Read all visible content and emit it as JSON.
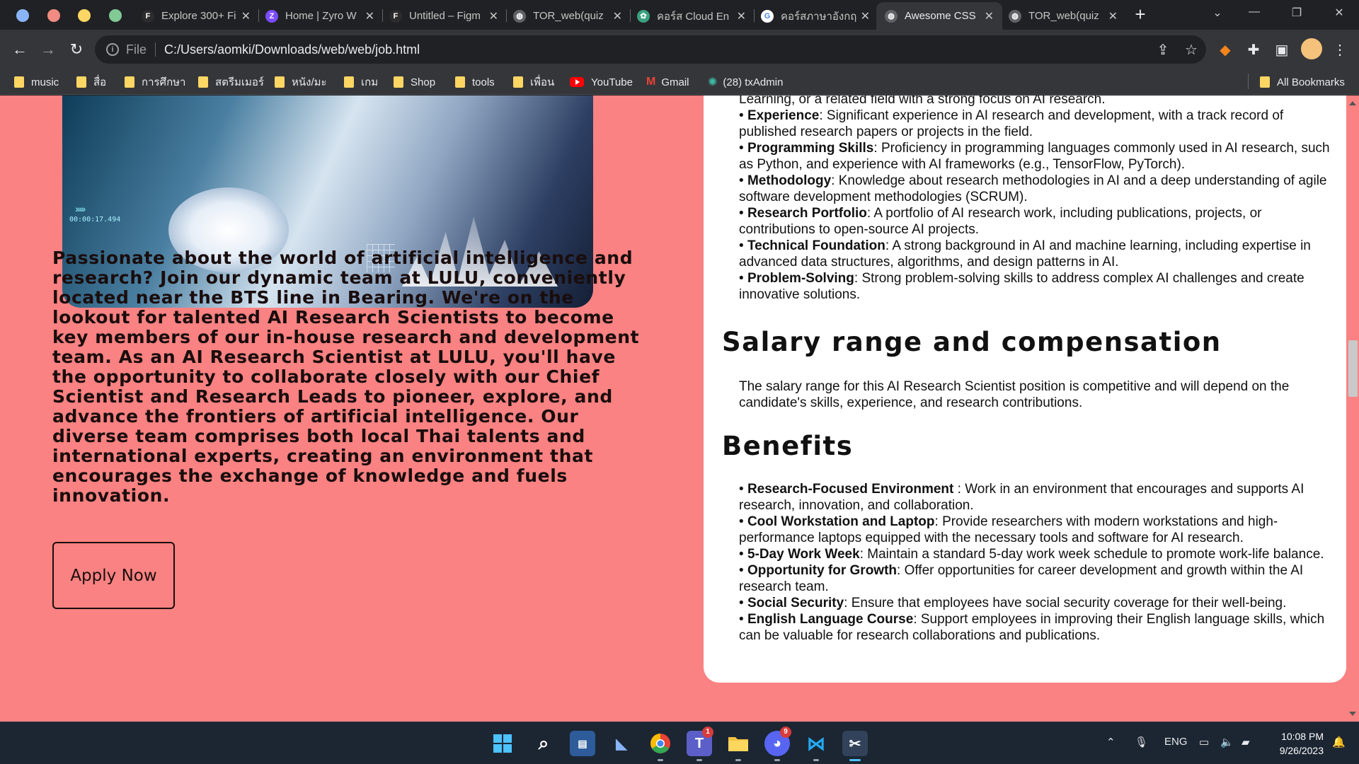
{
  "tabs": [
    {
      "title": "Explore 300+ Fi",
      "favicon_color": "#2c2c2c",
      "favicon_glyph": "F"
    },
    {
      "title": "Home | Zyro W",
      "favicon_color": "#7b4cff",
      "favicon_glyph": "Z"
    },
    {
      "title": "Untitled – Figm",
      "favicon_color": "#2c2c2c",
      "favicon_glyph": "F"
    },
    {
      "title": "TOR_web(quiz",
      "favicon_color": "#5f6368",
      "favicon_glyph": "◍"
    },
    {
      "title": "คอร์ส Cloud En",
      "favicon_color": "#3aa17e",
      "favicon_glyph": "✿"
    },
    {
      "title": "คอร์สภาษาอังกฤ",
      "favicon_color": "#ffffff",
      "favicon_glyph": "G"
    },
    {
      "title": "Awesome CSS",
      "favicon_color": "#5f6368",
      "favicon_glyph": "◍"
    },
    {
      "title": "TOR_web(quiz",
      "favicon_color": "#5f6368",
      "favicon_glyph": "◍"
    }
  ],
  "omnibox": {
    "scheme": "File",
    "url": "C:/Users/aomki/Downloads/web/web/job.html"
  },
  "bookmarks": [
    {
      "label": "music",
      "icon": "folder-icon"
    },
    {
      "label": "สื่อ",
      "icon": "folder-icon"
    },
    {
      "label": "การศึกษา",
      "icon": "folder-icon"
    },
    {
      "label": "สตรีมเมอร์",
      "icon": "folder-icon"
    },
    {
      "label": "หนัง/มะ",
      "icon": "folder-icon"
    },
    {
      "label": "เกม",
      "icon": "folder-icon"
    },
    {
      "label": "Shop",
      "icon": "folder-icon"
    },
    {
      "label": "tools",
      "icon": "folder-icon"
    },
    {
      "label": "เพื่อน",
      "icon": "folder-icon"
    },
    {
      "label": "YouTube",
      "icon": "youtube-icon"
    },
    {
      "label": "Gmail",
      "icon": "gmail-icon"
    },
    {
      "label": "(28) txAdmin",
      "icon": "txadmin-icon"
    }
  ],
  "all_bookmarks": "All Bookmarks",
  "page": {
    "hero_hud": "00:00:17.494",
    "intro": "Passionate about the world of artificial intelligence and research? Join our dynamic team at LULU, conveniently located near the BTS line in Bearing. We're on the lookout for talented AI Research Scientists to become key members of our in-house research and development team. As an AI Research Scientist at LULU, you'll have the opportunity to collaborate closely with our Chief Scientist and Research Leads to pioneer, explore, and advance the frontiers of artificial intelligence. Our diverse team comprises both local Thai talents and international experts, creating an environment that encourages the exchange of knowledge and fuels innovation.",
    "apply_label": "Apply Now",
    "cut_line": "Learning, or a related field with a strong focus on AI research.",
    "requirements": [
      {
        "bold": "Experience",
        "text": ": Significant experience in AI research and development, with a track record of published research papers or projects in the field."
      },
      {
        "bold": "Programming Skills",
        "text": ": Proficiency in programming languages commonly used in AI research, such as Python, and experience with AI frameworks (e.g., TensorFlow, PyTorch)."
      },
      {
        "bold": "Methodology",
        "text": ": Knowledge about research methodologies in AI and a deep understanding of agile software development methodologies (SCRUM)."
      },
      {
        "bold": "Research Portfolio",
        "text": ": A portfolio of AI research work, including publications, projects, or contributions to open-source AI projects."
      },
      {
        "bold": "Technical Foundation",
        "text": ": A strong background in AI and machine learning, including expertise in advanced data structures, algorithms, and design patterns in AI."
      },
      {
        "bold": "Problem-Solving",
        "text": ": Strong problem-solving skills to address complex AI challenges and create innovative solutions."
      }
    ],
    "salary_heading": "Salary range and compensation",
    "salary_text": "The salary range for this AI Research Scientist position is competitive and will depend on the candidate's skills, experience, and research contributions.",
    "benefits_heading": "Benefits",
    "benefits": [
      {
        "bold": "Research-Focused Environment",
        "text": " : Work in an environment that encourages and supports AI research, innovation, and collaboration."
      },
      {
        "bold": "Cool Workstation and Laptop",
        "text": ": Provide researchers with modern workstations and high-performance laptops equipped with the necessary tools and software for AI research."
      },
      {
        "bold": "5-Day Work Week",
        "text": ": Maintain a standard 5-day work week schedule to promote work-life balance."
      },
      {
        "bold": "Opportunity for Growth",
        "text": ": Offer opportunities for career development and growth within the AI research team."
      },
      {
        "bold": "Social Security",
        "text": ": Ensure that employees have social security coverage for their well-being."
      },
      {
        "bold": "English Language Course",
        "text": ": Support employees in improving their English language skills, which can be valuable for research collaborations and publications."
      }
    ]
  },
  "taskbar": {
    "apps": [
      "windows-start-icon",
      "search-icon",
      "file-explorer-app-icon",
      "copilot-icon",
      "chrome-icon",
      "teams-icon",
      "folder-icon",
      "discord-icon",
      "vscode-icon",
      "snipping-tool-icon"
    ],
    "teams_badge": "1",
    "discord_badge": "9",
    "language": "ENG",
    "time": "10:08 PM",
    "date": "9/26/2023"
  },
  "colors": {
    "page_bg": "#fa8282",
    "card_bg": "#ffffff",
    "chrome_dark": "#202124",
    "chrome_toolbar": "#35363a"
  }
}
